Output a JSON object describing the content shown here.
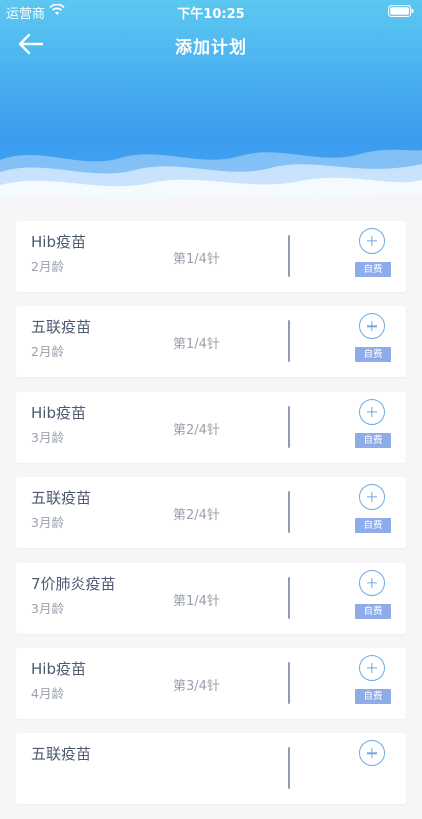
{
  "status_bar": {
    "carrier": "运营商",
    "time": "下午10:25"
  },
  "navbar": {
    "title": "添加计划"
  },
  "plans": [
    {
      "name": "Hib疫苗",
      "age": "2月龄",
      "dose": "第1/4针",
      "tag": "自费"
    },
    {
      "name": "五联疫苗",
      "age": "2月龄",
      "dose": "第1/4针",
      "tag": "自费"
    },
    {
      "name": "Hib疫苗",
      "age": "3月龄",
      "dose": "第2/4针",
      "tag": "自费"
    },
    {
      "name": "五联疫苗",
      "age": "3月龄",
      "dose": "第2/4针",
      "tag": "自费"
    },
    {
      "name": "7价肺炎疫苗",
      "age": "3月龄",
      "dose": "第1/4针",
      "tag": "自费"
    },
    {
      "name": "Hib疫苗",
      "age": "4月龄",
      "dose": "第3/4针",
      "tag": "自费"
    },
    {
      "name": "五联疫苗",
      "age": "",
      "dose": "",
      "tag": ""
    }
  ],
  "colors": {
    "header_top": "#5cc8f0",
    "header_bottom": "#3a9cf0",
    "badge": "#8facea",
    "accent": "#6fa8e8"
  },
  "icons": {
    "back": "arrow-left-icon",
    "add": "plus-circle-icon",
    "wifi": "wifi-icon",
    "battery": "battery-icon"
  }
}
